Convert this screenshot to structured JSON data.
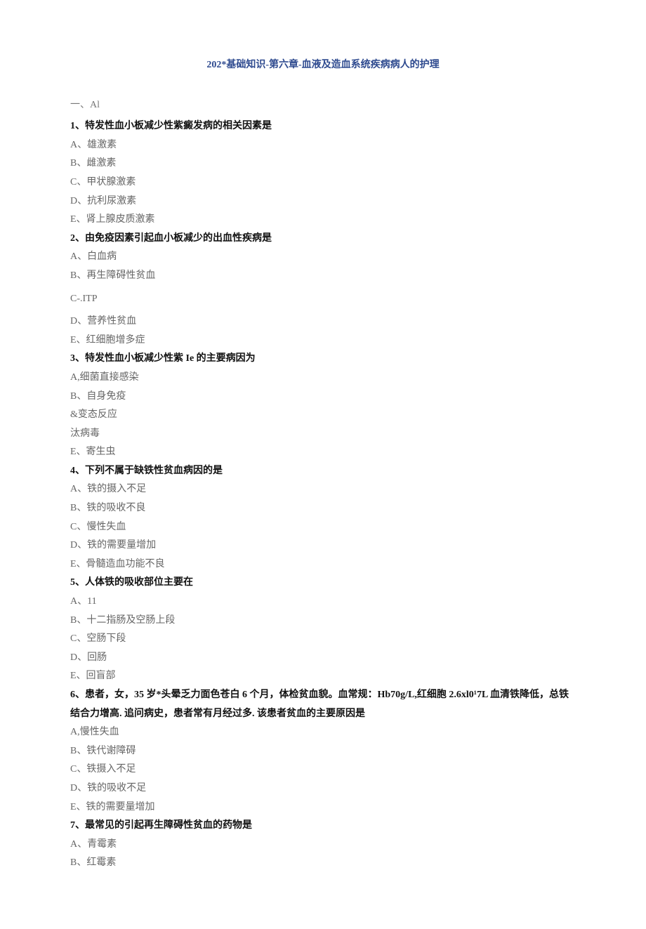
{
  "title": "202*基础知识-第六章-血液及造血系统疾病病人的护理",
  "sectionLabel": "一、Al",
  "questions": [
    {
      "q": "1、特发性血小板减少性紫癜发病的相关因素是",
      "opts": [
        "A、雄激素",
        "B、雌激素",
        "C、甲状腺激素",
        "D、抗利尿激素",
        "E、肾上腺皮质激素"
      ]
    },
    {
      "q": "2、由免疫因素引起血小板减少的出血性疾病是",
      "opts": [
        "A、白血病",
        "B、再生障碍性贫血",
        "C-.ITP",
        "D、营养性贫血",
        "E、红细胞增多症"
      ]
    },
    {
      "q": "3、特发性血小板减少性紫 Ie 的主要病因为",
      "opts": [
        "A,细菌直接感染",
        "B、自身免疫",
        "&变态反应",
        "汰病毒",
        "E、寄生虫"
      ]
    },
    {
      "q": "4、下列不属于缺铁性贫血病因的是",
      "opts": [
        "A、铁的摄入不足",
        "B、铁的吸收不良",
        "C、慢性失血",
        "D、铁的需要量增加",
        "E、骨髓造血功能不良"
      ]
    },
    {
      "q": "5、人体铁的吸收部位主要在",
      "opts": [
        "A、11",
        "B、十二指肠及空肠上段",
        "C、空肠下段",
        "D、回肠",
        "E、回盲部"
      ]
    },
    {
      "q": "6、患者，女，35 岁*头晕乏力面色苍白 6 个月，体检贫血貌。血常规：Hb70g/L,红细胞 2.6xl0¹7L 血清铁降低，总铁结合力增高. 追问病史，患者常有月经过多. 该患者贫血的主要原因是",
      "opts": [
        "A,慢性失血",
        "B、铁代谢障碍",
        "C、铁摄入不足",
        "D、铁的吸收不足",
        "E、铁的需要量增加"
      ]
    },
    {
      "q": "7、最常见的引起再生障碍性贫血的药物是",
      "opts": [
        "A、青霉素",
        "B、红霉素"
      ]
    }
  ]
}
